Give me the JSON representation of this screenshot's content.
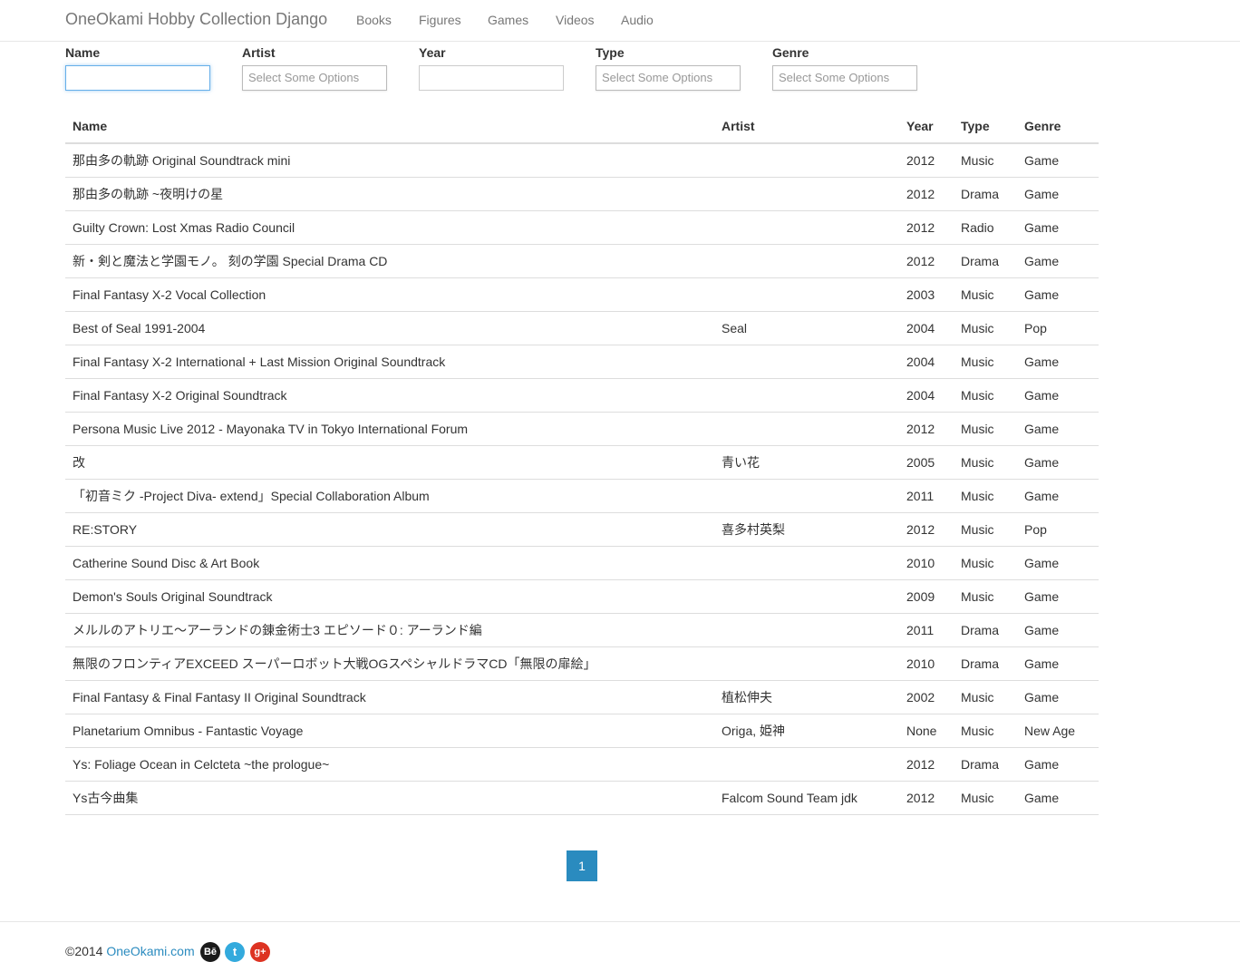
{
  "navbar": {
    "brand": "OneOkami Hobby Collection Django",
    "items": [
      {
        "label": "Books"
      },
      {
        "label": "Figures"
      },
      {
        "label": "Games"
      },
      {
        "label": "Videos"
      },
      {
        "label": "Audio"
      }
    ]
  },
  "filters": {
    "name": {
      "label": "Name",
      "value": ""
    },
    "artist": {
      "label": "Artist",
      "placeholder": "Select Some Options"
    },
    "year": {
      "label": "Year",
      "value": ""
    },
    "type": {
      "label": "Type",
      "placeholder": "Select Some Options"
    },
    "genre": {
      "label": "Genre",
      "placeholder": "Select Some Options"
    }
  },
  "table": {
    "headers": [
      "Name",
      "Artist",
      "Year",
      "Type",
      "Genre"
    ],
    "rows": [
      [
        "那由多の軌跡 Original Soundtrack mini",
        "",
        "2012",
        "Music",
        "Game"
      ],
      [
        "那由多の軌跡 ~夜明けの星",
        "",
        "2012",
        "Drama",
        "Game"
      ],
      [
        "Guilty Crown: Lost Xmas Radio Council",
        "",
        "2012",
        "Radio",
        "Game"
      ],
      [
        "新・剣と魔法と学園モノ。 刻の学園 Special Drama CD",
        "",
        "2012",
        "Drama",
        "Game"
      ],
      [
        "Final Fantasy X-2 Vocal Collection",
        "",
        "2003",
        "Music",
        "Game"
      ],
      [
        "Best of Seal 1991-2004",
        "Seal",
        "2004",
        "Music",
        "Pop"
      ],
      [
        "Final Fantasy X-2 International + Last Mission Original Soundtrack",
        "",
        "2004",
        "Music",
        "Game"
      ],
      [
        "Final Fantasy X-2 Original Soundtrack",
        "",
        "2004",
        "Music",
        "Game"
      ],
      [
        "Persona Music Live 2012 - Mayonaka TV in Tokyo International Forum",
        "",
        "2012",
        "Music",
        "Game"
      ],
      [
        "改",
        "青い花",
        "2005",
        "Music",
        "Game"
      ],
      [
        "「初音ミク -Project Diva- extend」Special Collaboration Album",
        "",
        "2011",
        "Music",
        "Game"
      ],
      [
        "RE:STORY",
        "喜多村英梨",
        "2012",
        "Music",
        "Pop"
      ],
      [
        "Catherine Sound Disc & Art Book",
        "",
        "2010",
        "Music",
        "Game"
      ],
      [
        "Demon's Souls Original Soundtrack",
        "",
        "2009",
        "Music",
        "Game"
      ],
      [
        "メルルのアトリエ〜アーランドの錬金術士3 エピソード０: アーランド編",
        "",
        "2011",
        "Drama",
        "Game"
      ],
      [
        "無限のフロンティアEXCEED スーパーロボット大戦OGスペシャルドラマCD「無限の扉絵」",
        "",
        "2010",
        "Drama",
        "Game"
      ],
      [
        "Final Fantasy & Final Fantasy II Original Soundtrack",
        "植松伸夫",
        "2002",
        "Music",
        "Game"
      ],
      [
        "Planetarium Omnibus - Fantastic Voyage",
        "Origa, 姫神",
        "None",
        "Music",
        "New Age"
      ],
      [
        "Ys: Foliage Ocean in Celcteta ~the prologue~",
        "",
        "2012",
        "Drama",
        "Game"
      ],
      [
        "Ys古今曲集",
        "Falcom Sound Team jdk",
        "2012",
        "Music",
        "Game"
      ]
    ]
  },
  "pagination": {
    "current": "1"
  },
  "footer": {
    "copyright": "©2014 ",
    "site": "OneOkami.com",
    "social": [
      {
        "icon": "behance-icon",
        "glyph": "Bē"
      },
      {
        "icon": "twitter-icon",
        "glyph": "t"
      },
      {
        "icon": "google-plus-icon",
        "glyph": "g+"
      }
    ]
  },
  "colors": {
    "link": "#2a8bbf",
    "pagination_active": "#2a8bbf",
    "focus_border": "#66afe9"
  }
}
